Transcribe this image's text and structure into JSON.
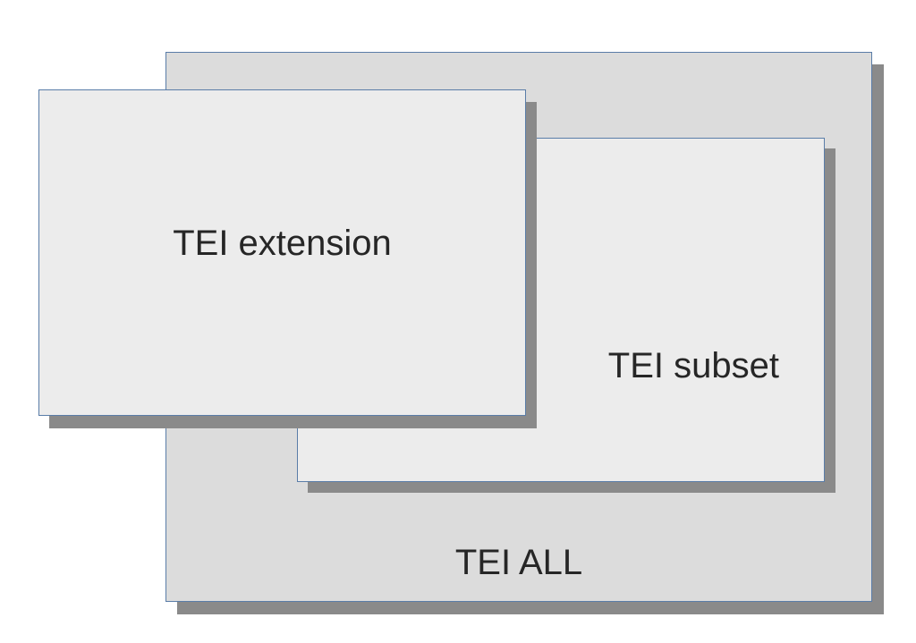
{
  "diagram": {
    "outer": {
      "label": "TEI ALL"
    },
    "middle": {
      "label": "TEI subset"
    },
    "top": {
      "label": "TEI extension"
    }
  }
}
